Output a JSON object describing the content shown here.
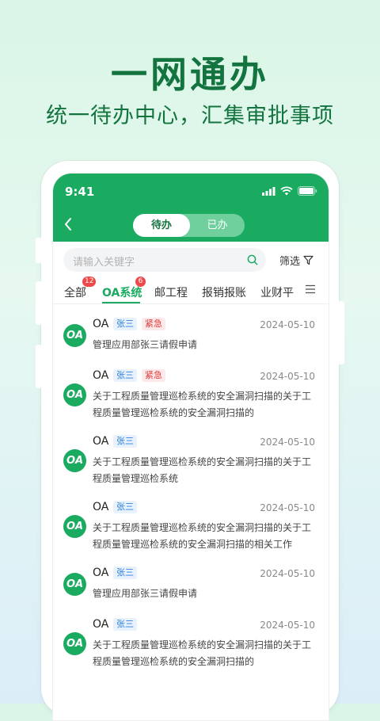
{
  "hero": {
    "title": "一网通办",
    "subtitle": "统一待办中心，汇集审批事项"
  },
  "status_bar": {
    "time": "9:41"
  },
  "segment": {
    "active": "待办",
    "inactive": "已办"
  },
  "search": {
    "placeholder": "请输入关键字",
    "filter_label": "筛选"
  },
  "tabs": [
    {
      "label": "全部",
      "badge": "12"
    },
    {
      "label": "OA系统",
      "badge": "6",
      "active": true
    },
    {
      "label": "邮工程"
    },
    {
      "label": "报销报账"
    },
    {
      "label": "业财平"
    }
  ],
  "items": [
    {
      "app": "OA",
      "title": "OA",
      "person": "张三",
      "urgent": "紧急",
      "date": "2024-05-10",
      "desc": "管理应用部张三请假申请"
    },
    {
      "app": "OA",
      "title": "OA",
      "person": "张三",
      "urgent": "紧急",
      "date": "2024-05-10",
      "desc": "关于工程质量管理巡检系统的安全漏洞扫描的关于工程质量管理巡检系统的安全漏洞扫描的"
    },
    {
      "app": "OA",
      "title": "OA",
      "person": "张三",
      "date": "2024-05-10",
      "desc": "关于工程质量管理巡检系统的安全漏洞扫描的关于工程质量管理巡检系统"
    },
    {
      "app": "OA",
      "title": "OA",
      "person": "张三",
      "date": "2024-05-10",
      "desc": "关于工程质量管理巡检系统的安全漏洞扫描的关于工程质量管理巡检系统的安全漏洞扫描的相关工作"
    },
    {
      "app": "OA",
      "title": "OA",
      "person": "张三",
      "date": "2024-05-10",
      "desc": "管理应用部张三请假申请"
    },
    {
      "app": "OA",
      "title": "OA",
      "person": "张三",
      "date": "2024-05-10",
      "desc": "关于工程质量管理巡检系统的安全漏洞扫描的关于工程质量管理巡检系统的安全漏洞扫描的"
    }
  ],
  "colors": {
    "brand": "#1aab61",
    "hero_text": "#14743f",
    "urgent": "#e23c3c",
    "tag": "#2f7fe0"
  }
}
